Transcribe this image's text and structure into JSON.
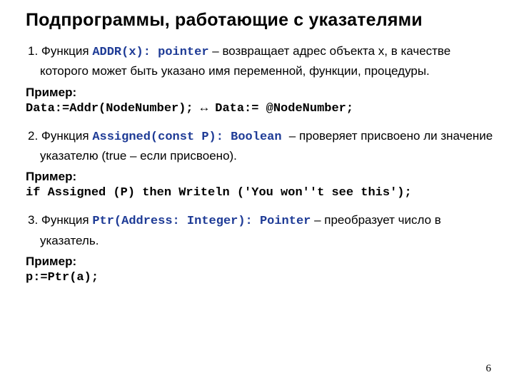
{
  "title": "Подпрограммы, работающие с указателями",
  "item1": {
    "pre": "1. Функция ",
    "func": "ADDR(x): pointer",
    "post": " – возвращает адрес объекта x, в качестве которого может быть указано имя переменной, функции, процедуры."
  },
  "primer": "Пример:",
  "code1": "Data:=Addr(NodeNumber); ↔ Data:= @NodeNumber;",
  "item2": {
    "pre": "2. Функция ",
    "func": "Assigned(const P): Boolean ",
    "post": " – проверяет присвоено ли значение указателю (true – если присвоено)."
  },
  "code2": "if Assigned (P) then Writeln ('You won''t see this');",
  "item3": {
    "pre": "3. Функция ",
    "func": "Ptr(Address: Integer): Pointer",
    "post": " – преобразует число в указатель."
  },
  "code3": "p:=Ptr(a);",
  "page": "6"
}
